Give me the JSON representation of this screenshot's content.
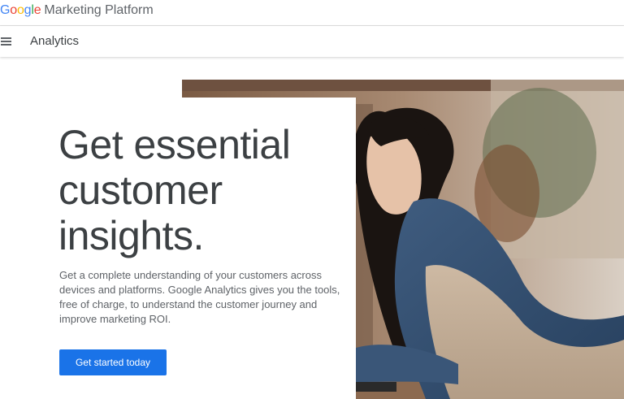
{
  "brand": {
    "google_letters": [
      {
        "char": "G",
        "color": "#4285F4"
      },
      {
        "char": "o",
        "color": "#EA4335"
      },
      {
        "char": "o",
        "color": "#FBBC05"
      },
      {
        "char": "g",
        "color": "#4285F4"
      },
      {
        "char": "l",
        "color": "#34A853"
      },
      {
        "char": "e",
        "color": "#EA4335"
      }
    ],
    "platform": "Marketing Platform"
  },
  "nav": {
    "menu_icon": "hamburger-menu-icon",
    "title": "Analytics"
  },
  "hero": {
    "headline_lines": [
      "Get essential",
      "customer",
      "insights."
    ],
    "description_lines": [
      "Get a complete understanding of your customers across",
      "devices and platforms. Google Analytics gives you the tools,",
      "free of charge, to understand the customer journey and",
      "improve marketing ROI."
    ],
    "cta_label": "Get started today",
    "image": "woman-working-at-laptop-photo"
  },
  "colors": {
    "cta": "#1a73e8",
    "text": "#3c4043"
  }
}
